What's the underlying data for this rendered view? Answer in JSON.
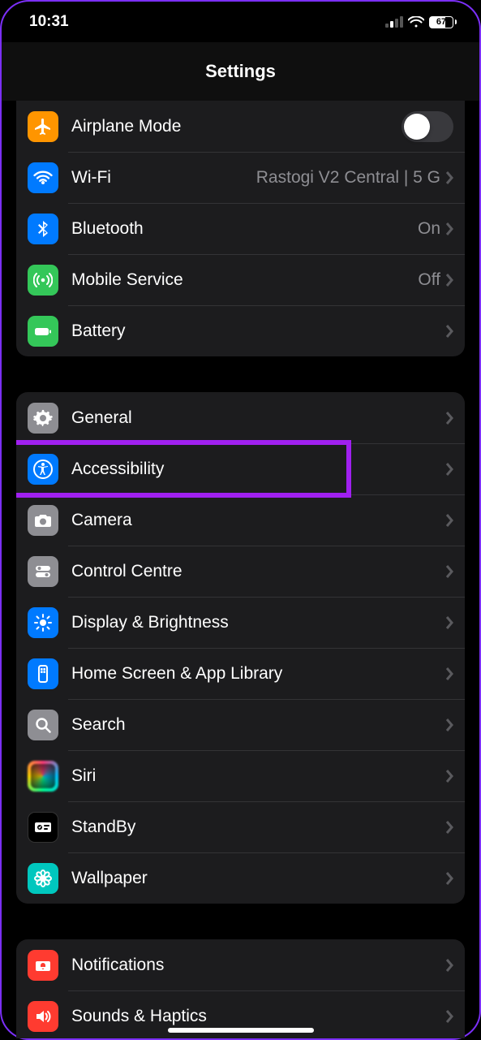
{
  "status": {
    "time": "10:31",
    "battery_percent": "67"
  },
  "header": {
    "title": "Settings"
  },
  "groups": [
    {
      "items": [
        {
          "key": "airplane",
          "label": "Airplane Mode",
          "icon": "airplane",
          "bg": "#ff9500",
          "accessory": "toggle",
          "toggle_on": false
        },
        {
          "key": "wifi",
          "label": "Wi-Fi",
          "icon": "wifi",
          "bg": "#007aff",
          "accessory": "disclosure",
          "value": "Rastogi V2 Central |  5 G"
        },
        {
          "key": "bluetooth",
          "label": "Bluetooth",
          "icon": "bluetooth",
          "bg": "#007aff",
          "accessory": "disclosure",
          "value": "On"
        },
        {
          "key": "mobile",
          "label": "Mobile Service",
          "icon": "antenna",
          "bg": "#34c759",
          "accessory": "disclosure",
          "value": "Off"
        },
        {
          "key": "battery",
          "label": "Battery",
          "icon": "battery",
          "bg": "#34c759",
          "accessory": "disclosure"
        }
      ]
    },
    {
      "items": [
        {
          "key": "general",
          "label": "General",
          "icon": "gear",
          "bg": "#8e8e93",
          "accessory": "disclosure"
        },
        {
          "key": "accessibility",
          "label": "Accessibility",
          "icon": "access",
          "bg": "#007aff",
          "accessory": "disclosure",
          "highlighted": true
        },
        {
          "key": "camera",
          "label": "Camera",
          "icon": "camera",
          "bg": "#8e8e93",
          "accessory": "disclosure"
        },
        {
          "key": "control",
          "label": "Control Centre",
          "icon": "switches",
          "bg": "#8e8e93",
          "accessory": "disclosure"
        },
        {
          "key": "display",
          "label": "Display & Brightness",
          "icon": "sun",
          "bg": "#007aff",
          "accessory": "disclosure"
        },
        {
          "key": "home",
          "label": "Home Screen & App Library",
          "icon": "phoneframe",
          "bg": "#007aff",
          "accessory": "disclosure"
        },
        {
          "key": "search",
          "label": "Search",
          "icon": "search",
          "bg": "#8e8e93",
          "accessory": "disclosure"
        },
        {
          "key": "siri",
          "label": "Siri",
          "icon": "siri",
          "bg": "siri",
          "accessory": "disclosure"
        },
        {
          "key": "standby",
          "label": "StandBy",
          "icon": "standby",
          "bg": "#000000",
          "accessory": "disclosure"
        },
        {
          "key": "wallpaper",
          "label": "Wallpaper",
          "icon": "flower",
          "bg": "#00c7be",
          "accessory": "disclosure"
        }
      ]
    },
    {
      "items": [
        {
          "key": "notifications",
          "label": "Notifications",
          "icon": "bell",
          "bg": "#ff3b30",
          "accessory": "disclosure"
        },
        {
          "key": "sounds",
          "label": "Sounds & Haptics",
          "icon": "speaker",
          "bg": "#ff3b30",
          "accessory": "disclosure"
        }
      ]
    }
  ]
}
